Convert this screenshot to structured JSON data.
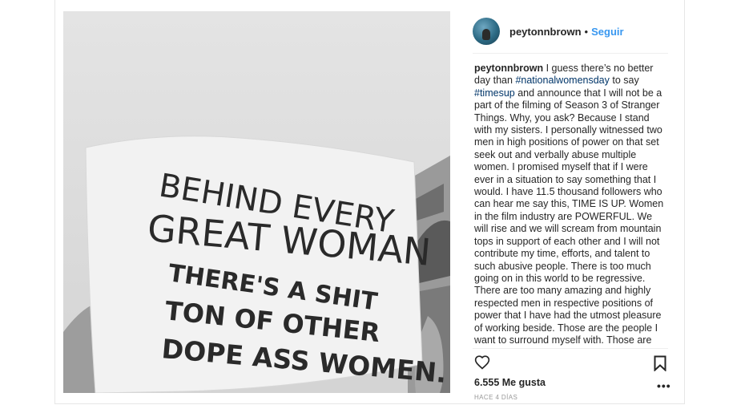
{
  "post": {
    "photo": {
      "sign_lines": [
        "BEHIND EVERY",
        "GREAT WOMAN",
        "THERE'S A SHIT",
        "TON OF  OTHER",
        "DOPE ASS WOMEN."
      ]
    },
    "header": {
      "username": "peytonnbrown",
      "separator": "•",
      "follow_label": "Seguir"
    },
    "caption": {
      "username": "peytonnbrown",
      "segments": [
        {
          "type": "text",
          "value": " I guess there’s no better day than "
        },
        {
          "type": "hashtag",
          "value": "#nationalwomensday"
        },
        {
          "type": "text",
          "value": " to say "
        },
        {
          "type": "hashtag",
          "value": "#timesup"
        },
        {
          "type": "text",
          "value": " and announce that I will not be a part of the filming of Season 3 of Stranger Things. Why, you ask? Because I stand with my sisters. I personally witnessed two men in high positions of power on that set seek out and verbally abuse multiple women. I promised myself that if I were ever in a situation to say something that I would. I have 11.5 thousand followers who can hear me say this, TIME IS UP. Women in the film industry are POWERFUL. We will rise and we will scream from mountain tops in support of each other and I will not contribute my time, efforts, and talent to such abusive people. There is too much going on in this world to be regressive. There are too many amazing and highly respected men in respective positions of power that I have had the utmost pleasure of working beside. Those are the people I want to surround myself with. Those are the projects I want to be a part of. This"
        }
      ]
    },
    "actions": {
      "likes": "6.555 Me gusta",
      "timestamp": "HACE 4 DÍAS",
      "more_label": "•••",
      "icons": [
        "heart-icon",
        "bookmark-icon",
        "more-options-icon"
      ]
    },
    "colors": {
      "link_blue": "#3897f0",
      "hashtag": "#003569",
      "text": "#262626",
      "muted": "#999999"
    }
  }
}
